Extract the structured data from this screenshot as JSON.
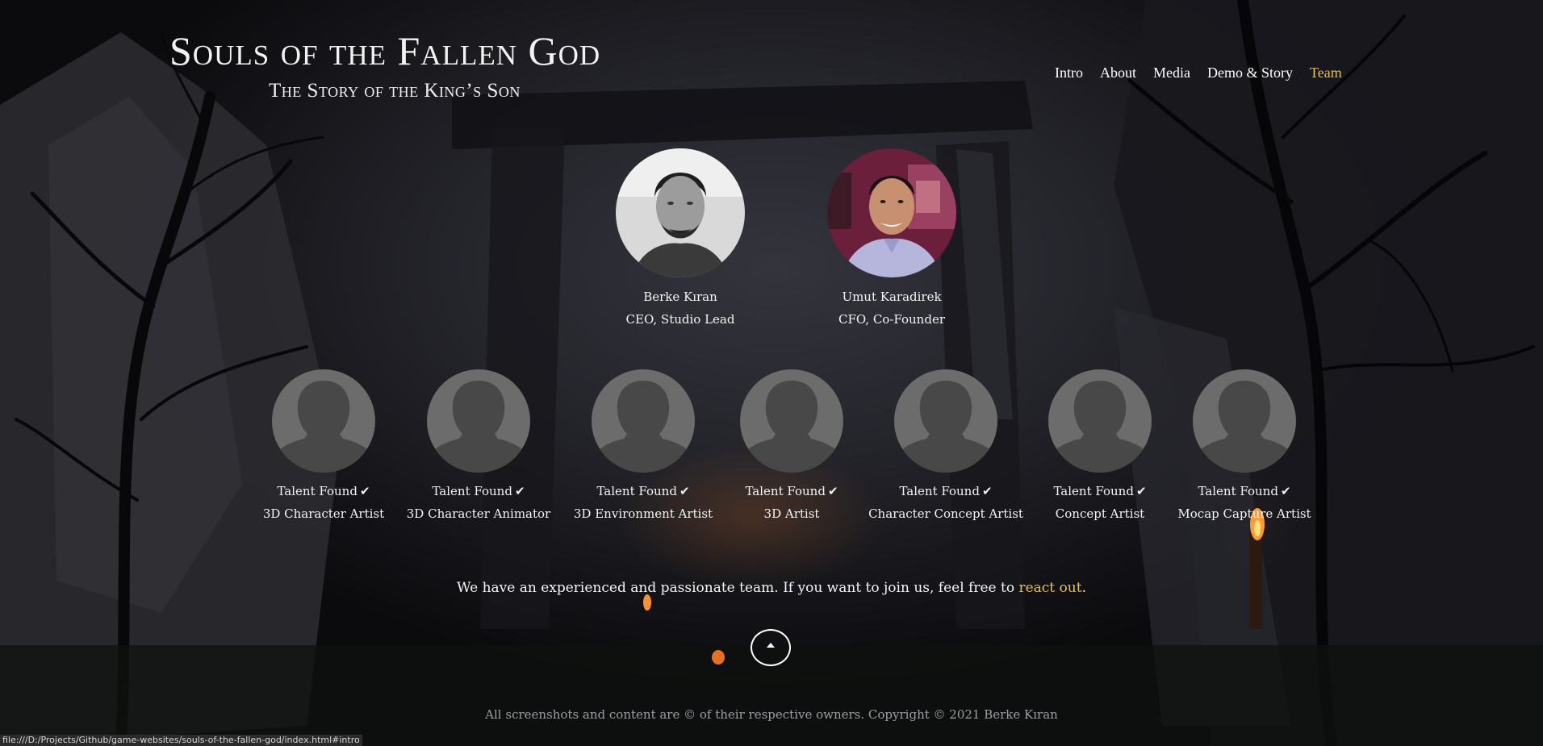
{
  "header": {
    "title": "Souls of the Fallen God",
    "subtitle": "The Story of the King’s Son"
  },
  "nav": {
    "items": [
      {
        "label": "Intro"
      },
      {
        "label": "About"
      },
      {
        "label": "Media"
      },
      {
        "label": "Demo & Story"
      },
      {
        "label": "Team",
        "active": true
      }
    ]
  },
  "leaders": [
    {
      "name": "Berke Kıran",
      "role": "CEO, Studio Lead"
    },
    {
      "name": "Umut Karadirek",
      "role": "CFO, Co-Founder"
    }
  ],
  "members": [
    {
      "status": "Talent Found",
      "role": "3D Character Artist"
    },
    {
      "status": "Talent Found",
      "role": "3D Character Animator"
    },
    {
      "status": "Talent Found",
      "role": "3D Environment Artist"
    },
    {
      "status": "Talent Found",
      "role": "3D Artist"
    },
    {
      "status": "Talent Found",
      "role": "Character Concept Artist"
    },
    {
      "status": "Talent Found",
      "role": "Concept Artist"
    },
    {
      "status": "Talent Found",
      "role": "Mocap Capture Artist"
    }
  ],
  "check_mark": "✔",
  "join": {
    "text": "We have an experienced and passionate team. If you want to join us, feel free to ",
    "link": "react out",
    "end": "."
  },
  "footer": {
    "text": "All screenshots and content are © of their respective owners. Copyright © 2021 Berke Kıran"
  },
  "browser_status_url": "file:///D:/Projects/Github/game-websites/souls-of-the-fallen-god/index.html#intro",
  "colors": {
    "accent": "#e8c24a",
    "text": "#ffffff",
    "avatar_placeholder": "#6c6c6c",
    "silhouette": "#484848"
  },
  "icons": {
    "scroll_top": "chevron-up-icon",
    "check": "check-icon",
    "placeholder_avatar": "person-silhouette-icon"
  }
}
